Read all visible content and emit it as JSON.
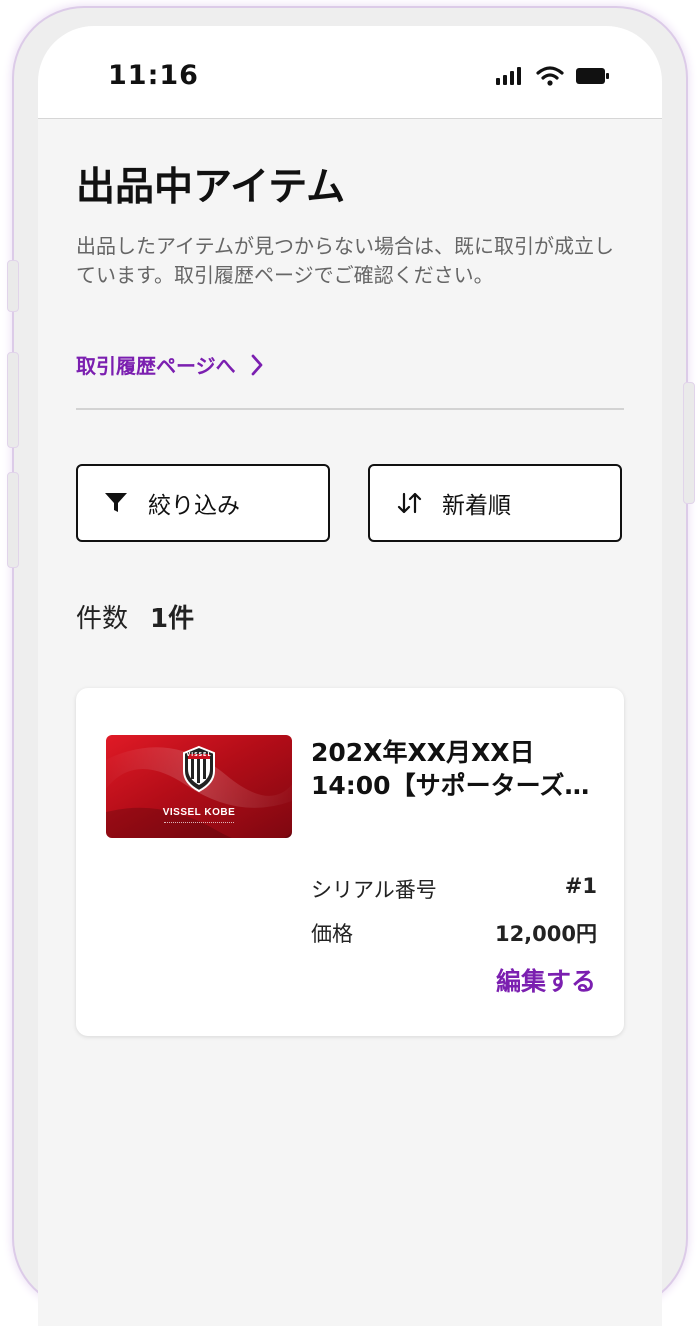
{
  "status_bar": {
    "time": "11:16",
    "icons": [
      "signal-icon",
      "wifi-icon",
      "battery-icon"
    ]
  },
  "page": {
    "title": "出品中アイテム",
    "description": "出品したアイテムが見つからない場合は、既に取引が成立しています。取引履歴ページでご確認ください。",
    "history_link": "取引履歴ページへ"
  },
  "toolbar": {
    "filter_label": "絞り込み",
    "filter_icon": "filter-icon",
    "sort_label": "新着順",
    "sort_icon": "sort-arrows-icon"
  },
  "count": {
    "label": "件数",
    "value": "1件"
  },
  "items": [
    {
      "title_line1": "202X年XX月XX日",
      "title_line2": "14:00【サポーターズ…",
      "thumbnail": {
        "brand": "VISSEL KOBE",
        "emblem_text": "VISSEL"
      },
      "serial_label": "シリアル番号",
      "serial_value": "#1",
      "price_label": "価格",
      "price_value": "12,000円",
      "edit_label": "編集する"
    }
  ],
  "colors": {
    "accent": "#7b1fb0",
    "card_red": "#c8101e",
    "background": "#f5f5f5"
  }
}
